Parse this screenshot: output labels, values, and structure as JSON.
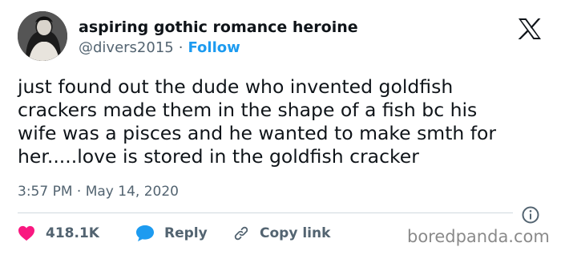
{
  "author": {
    "display_name": "aspiring gothic romance heroine",
    "handle": "@divers2015",
    "separator": "·",
    "follow_label": "Follow",
    "avatar_icon": "avatar-photo"
  },
  "brand": {
    "logo_icon": "x-logo-icon"
  },
  "tweet": {
    "text": "just found out the dude who invented goldfish\ncrackers made them in the shape of a fish bc his\nwife was a pisces and he wanted to make smth for\nher.....love is stored in the goldfish cracker",
    "timestamp": "3:57 PM · May 14, 2020"
  },
  "actions": {
    "like_count": "418.1K",
    "reply_label": "Reply",
    "copy_link_label": "Copy link"
  },
  "watermark": "boredpanda.com",
  "colors": {
    "text": "#0f1419",
    "secondary": "#536471",
    "accent": "#1d9bf0",
    "like": "#f91880"
  }
}
